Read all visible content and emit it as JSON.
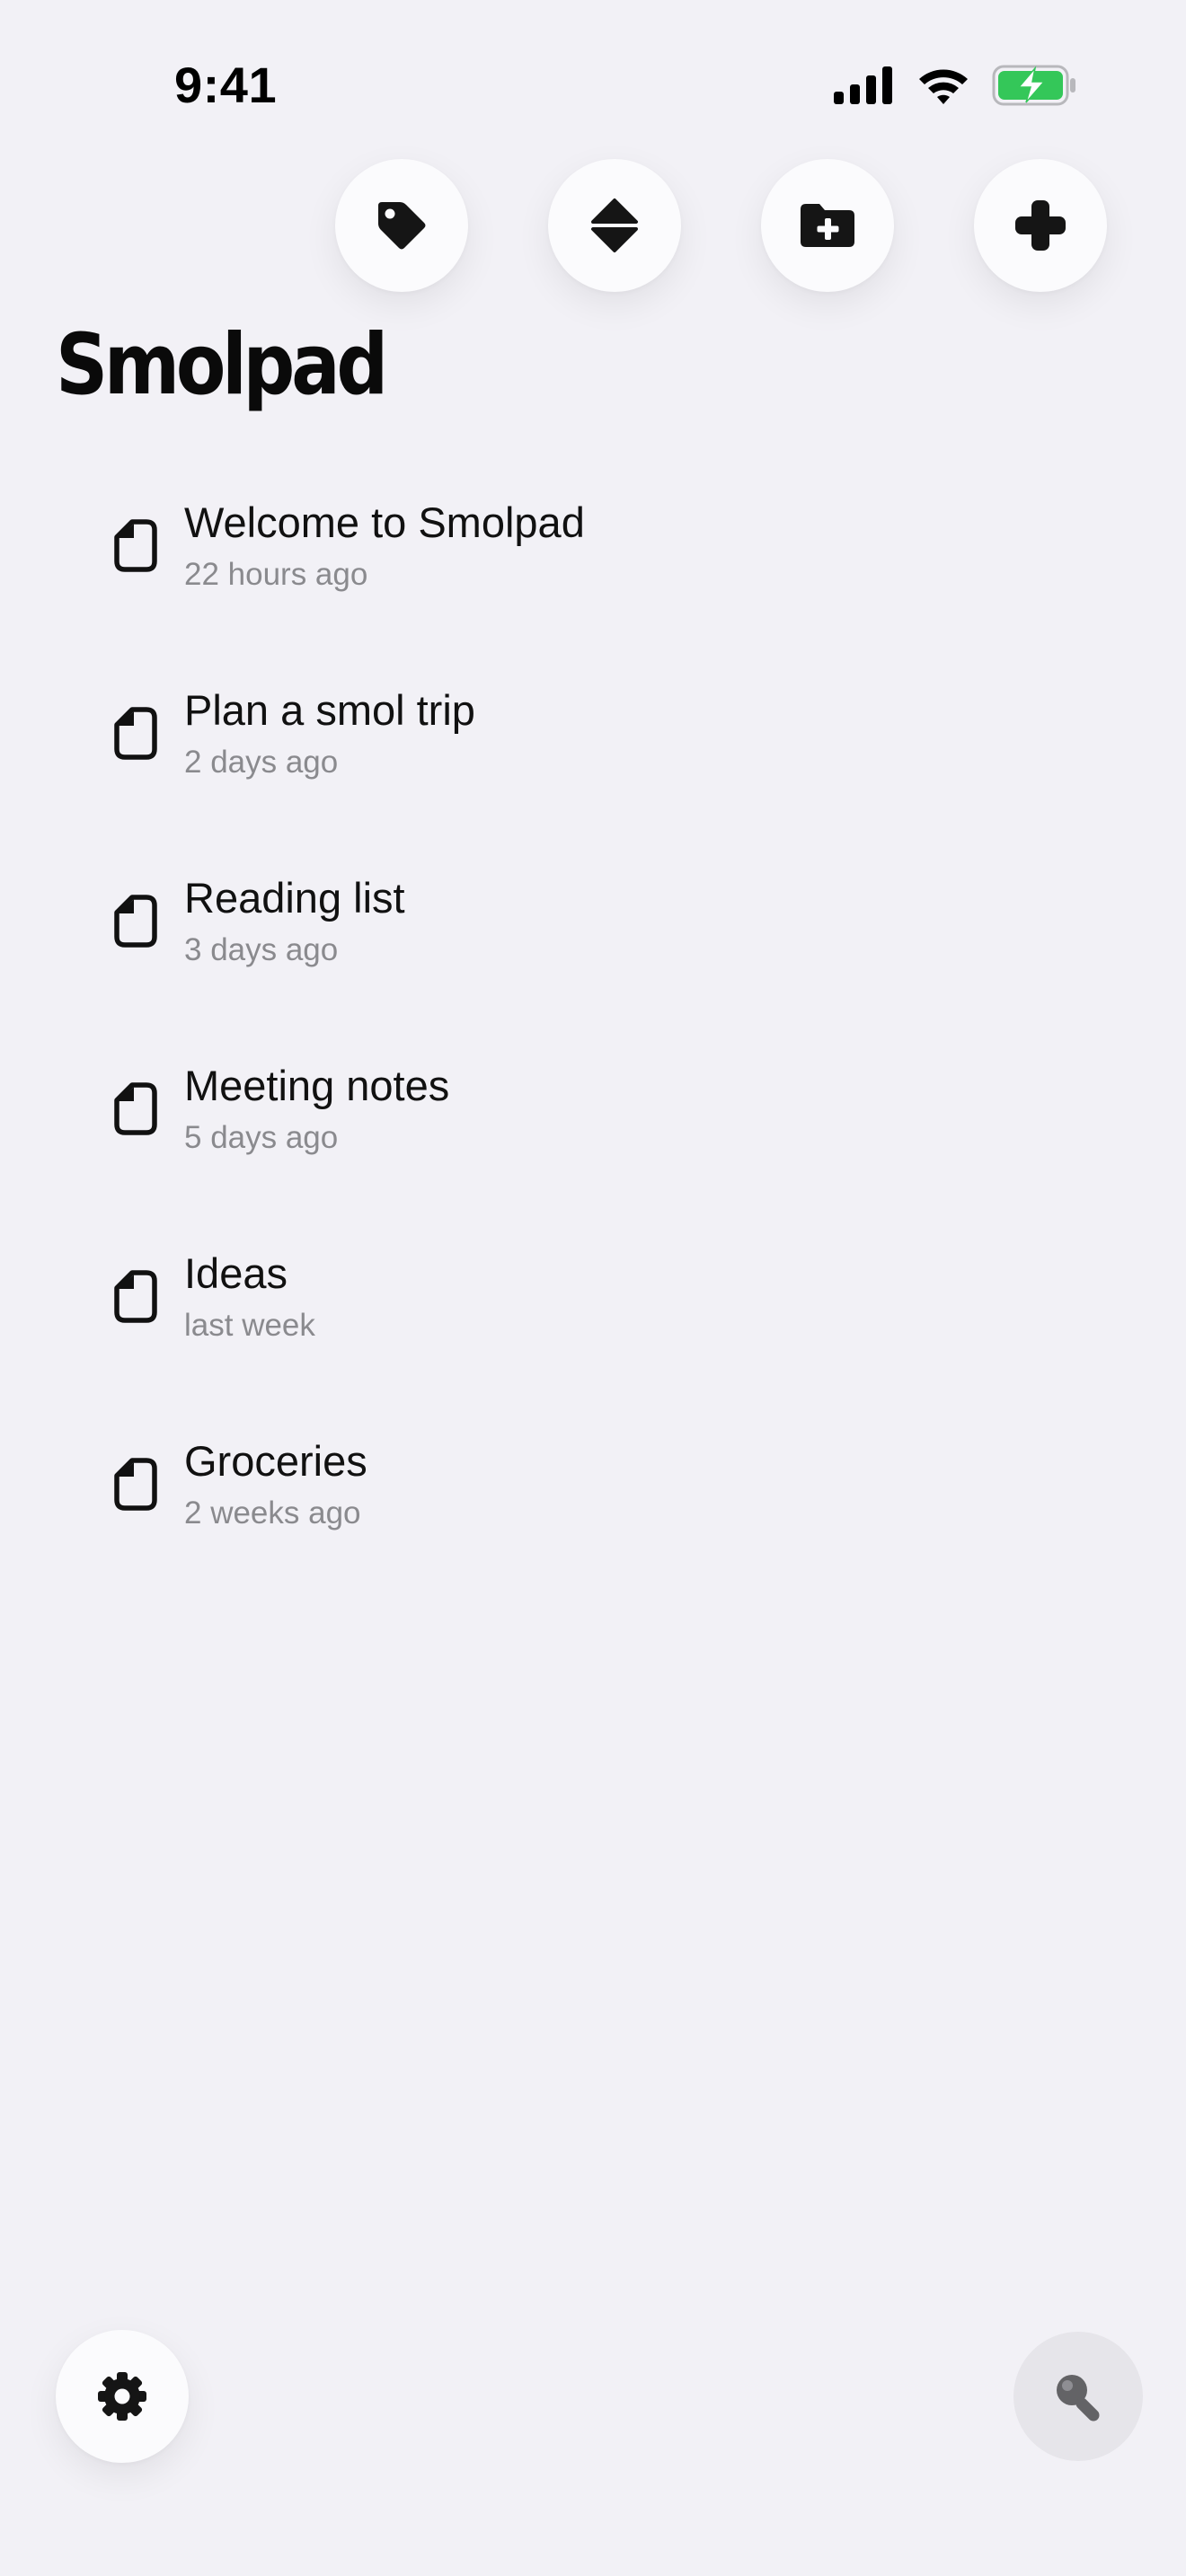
{
  "status_bar": {
    "time": "9:41",
    "battery_color": "#34c759"
  },
  "toolbar": {
    "buttons": [
      {
        "icon": "tag-icon"
      },
      {
        "icon": "sort-icon"
      },
      {
        "icon": "folder-plus-icon"
      },
      {
        "icon": "plus-icon"
      }
    ]
  },
  "app_title": "Smolpad",
  "notes": [
    {
      "title": "Welcome to Smolpad",
      "time": "22 hours ago"
    },
    {
      "title": "Plan a smol trip",
      "time": "2 days ago"
    },
    {
      "title": "Reading list",
      "time": "3 days ago"
    },
    {
      "title": "Meeting notes",
      "time": "5 days ago"
    },
    {
      "title": "Ideas",
      "time": "last week"
    },
    {
      "title": "Groceries",
      "time": "2 weeks ago"
    }
  ],
  "bottom": {
    "settings_icon": "gear-icon",
    "search_icon": "search-icon"
  }
}
